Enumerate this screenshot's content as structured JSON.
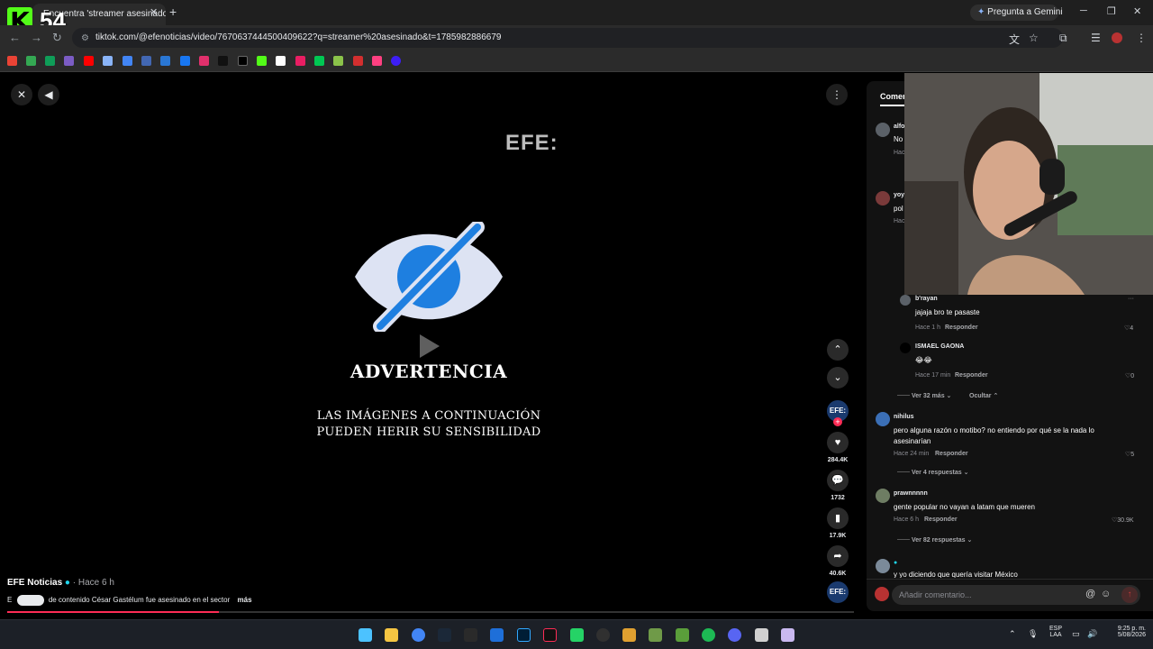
{
  "browser": {
    "tab_title": "Encuentra 'streamer asesinado'",
    "new_tab": "+",
    "gemini_label": "Pregunta a Gemini",
    "url": "tiktok.com/@efenoticias/video/7670637444500409622?q=streamer%20asesinado&t=1785982886679"
  },
  "overlay": {
    "kick_letter": "K",
    "viewer_count": "54"
  },
  "video": {
    "watermark": "EFE:",
    "warning_title": "ADVERTENCIA",
    "warning_line1": "LAS IMÁGENES A CONTINUACIÓN",
    "warning_line2": "PUEDEN HERIR SU SENSIBILIDAD",
    "author": "EFE Noticias",
    "time_ago": "· Hace 6 h",
    "description": "de contenido César Gastélum fue asesinado en el sector",
    "more": "más",
    "progress_fraction": 0.25,
    "side": {
      "avatar": "EFE:",
      "likes": "284.4K",
      "comments": "1732",
      "saves": "17.9K",
      "shares": "40.6K"
    }
  },
  "comments": {
    "tab_label": "Comen",
    "placeholder": "Añadir comentario...",
    "items": [
      {
        "name": "b'rayan",
        "text": "jajaja bro te pasaste",
        "time": "Hace 1 h",
        "reply": "Responder",
        "likes": "4"
      },
      {
        "name": "ISMAEL GAONA",
        "text": "😂😂",
        "time": "Hace 17 min",
        "reply": "Responder",
        "likes": "0"
      },
      {
        "name": "nihilus",
        "text": "pero alguna razón o motibo? no entiendo por qué se la nada lo",
        "text2": "asesinarían",
        "time": "Hace 24 min",
        "reply": "Responder",
        "likes": "5"
      },
      {
        "name": "prawnnnnn",
        "text": "gente popular no vayan a latam que mueren",
        "time": "Hace 6 h",
        "reply": "Responder",
        "likes": "30.9K"
      },
      {
        "name": "",
        "text": "y yo diciendo que quería visitar México"
      }
    ],
    "more_replies_1": "Ver 32 más",
    "hide": "Ocultar",
    "more_replies_2": "Ver 4 respuestas",
    "more_replies_3": "Ver 82 respuestas",
    "partial_names": [
      "alfo",
      "yoy"
    ],
    "partial_texts": [
      "No",
      "pol"
    ],
    "partial_meta": [
      "Hac",
      "Hac"
    ]
  },
  "taskbar": {
    "lang1": "ESP",
    "lang2": "LAA",
    "time": "9:25 p. m.",
    "date": "5/08/2026"
  },
  "colors": {
    "tiktok_red": "#fe2c55",
    "kick_green": "#53fc18",
    "eye_blue": "#1e7fe0"
  }
}
